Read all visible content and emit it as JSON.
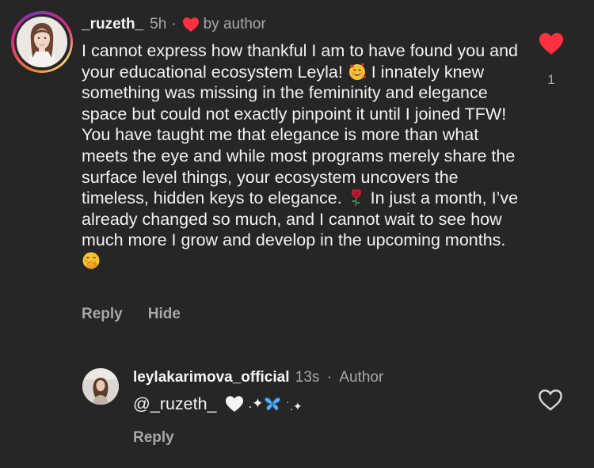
{
  "comment": {
    "username": "_ruzeth_",
    "time": "5h",
    "separator": "·",
    "liked_by": "by author",
    "text_lines_part1": "I cannot express how thankful I am to have found you and your educational ecosystem Leyla! ",
    "text_part2": " I innately knew something was missing in the femininity and elegance space but could not exactly pinpoint it until I joined TFW! You have taught me that elegance is more than what meets the eye and while most programs merely share the surface level things, your ecosystem uncovers the timeless, hidden keys to elegance. ",
    "text_part3": " In just a month, I’ve already changed so much, and I cannot wait to see how much more I grow and develop in the upcoming months. ",
    "reply_label": "Reply",
    "hide_label": "Hide",
    "like_count": "1",
    "like_color": "#ff3040"
  },
  "reply": {
    "username": "leylakarimova_official",
    "time": "13s",
    "separator": "·",
    "role": "Author",
    "mention": "@_ruzeth_",
    "decor_text": ".✦",
    "decor_text2": "˙.✦",
    "reply_label": "Reply"
  },
  "icons": {
    "comment_like": "heart-filled-icon",
    "reply_like": "heart-outline-icon",
    "emojis": [
      "smiling-face-with-hearts-emoji",
      "rose-emoji",
      "face-with-hand-over-mouth-emoji",
      "white-heart-emoji",
      "butterfly-emoji"
    ]
  }
}
